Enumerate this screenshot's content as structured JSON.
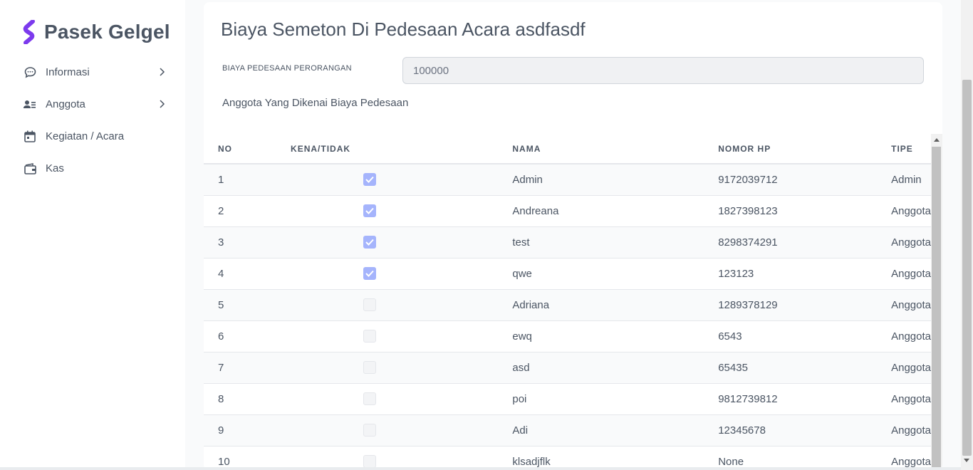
{
  "brand": {
    "name": "Pasek Gelgel"
  },
  "sidebar": {
    "items": [
      {
        "label": "Informasi",
        "icon": "chat-bubble-icon",
        "has_submenu": true
      },
      {
        "label": "Anggota",
        "icon": "user-list-icon",
        "has_submenu": true
      },
      {
        "label": "Kegiatan / Acara",
        "icon": "calendar-icon",
        "has_submenu": false
      },
      {
        "label": "Kas",
        "icon": "wallet-icon",
        "has_submenu": false
      }
    ]
  },
  "main": {
    "title": "Biaya Semeton Di Pedesaan Acara asdfasdf",
    "field_label": "BIAYA PEDESAAN PERORANGAN",
    "field_value": "100000",
    "subheading": "Anggota Yang Dikenai Biaya Pedesaan",
    "table": {
      "headers": {
        "no": "NO",
        "kena": "KENA/TIDAK",
        "nama": "NAMA",
        "hp": "NOMOR HP",
        "tipe": "TIPE"
      },
      "rows": [
        {
          "no": "1",
          "checked": true,
          "nama": "Admin",
          "hp": "9172039712",
          "tipe": "Admin"
        },
        {
          "no": "2",
          "checked": true,
          "nama": "Andreana",
          "hp": "1827398123",
          "tipe": "Anggota"
        },
        {
          "no": "3",
          "checked": true,
          "nama": "test",
          "hp": "8298374291",
          "tipe": "Anggota"
        },
        {
          "no": "4",
          "checked": true,
          "nama": "qwe",
          "hp": "123123",
          "tipe": "Anggota"
        },
        {
          "no": "5",
          "checked": false,
          "nama": "Adriana",
          "hp": "1289378129",
          "tipe": "Anggota"
        },
        {
          "no": "6",
          "checked": false,
          "nama": "ewq",
          "hp": "6543",
          "tipe": "Anggota"
        },
        {
          "no": "7",
          "checked": false,
          "nama": "asd",
          "hp": "65435",
          "tipe": "Anggota"
        },
        {
          "no": "8",
          "checked": false,
          "nama": "poi",
          "hp": "9812739812",
          "tipe": "Anggota"
        },
        {
          "no": "9",
          "checked": false,
          "nama": "Adi",
          "hp": "12345678",
          "tipe": "Anggota"
        },
        {
          "no": "10",
          "checked": false,
          "nama": "klsadjflk",
          "hp": "None",
          "tipe": "Anggota"
        }
      ]
    }
  },
  "colors": {
    "accent": "#7c3aed",
    "checkbox_checked": "#a5b4fc",
    "text": "#4b5563"
  }
}
